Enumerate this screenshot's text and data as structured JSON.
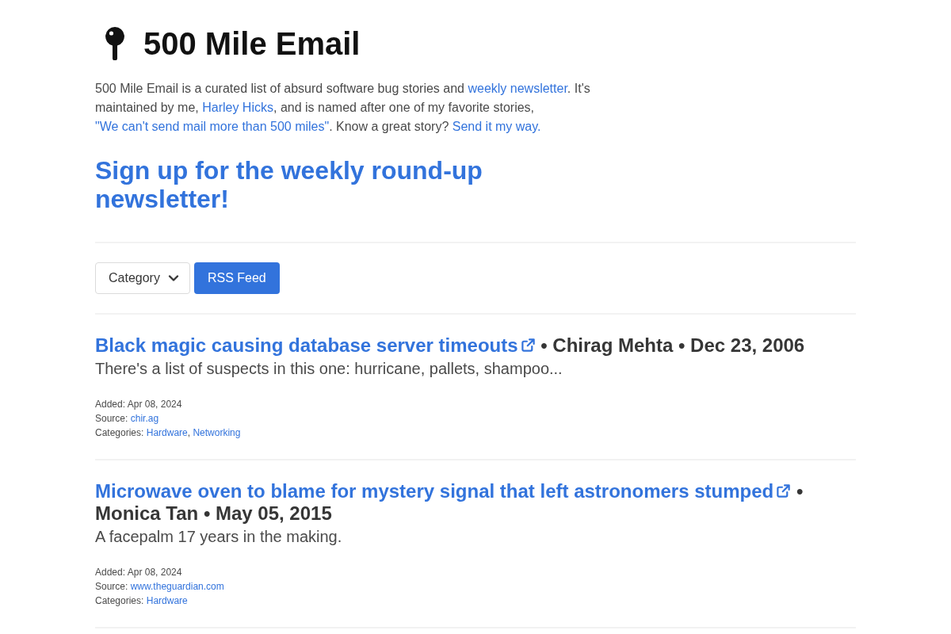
{
  "header": {
    "title": "500 Mile Email"
  },
  "intro": [
    {
      "kind": "text",
      "text": "500 Mile Email is a curated list of absurd software bug stories and "
    },
    {
      "kind": "link",
      "text": "weekly newsletter"
    },
    {
      "kind": "text",
      "text": ". It's maintained by me, "
    },
    {
      "kind": "link",
      "text": "Harley Hicks"
    },
    {
      "kind": "text",
      "text": ", and is named after one of my favorite stories, "
    },
    {
      "kind": "link",
      "text": "\"We can't send mail more than 500 miles\""
    },
    {
      "kind": "text",
      "text": ". Know a great story? "
    },
    {
      "kind": "link",
      "text": "Send it my way."
    }
  ],
  "signup": {
    "label": "Sign up for the weekly round-up newsletter!"
  },
  "filters": {
    "category_dropdown": {
      "label": "Category"
    },
    "rss_button": {
      "label": "RSS Feed"
    }
  },
  "stories": [
    {
      "title": "Black magic causing database server timeouts",
      "byline": {
        "separators": [
          "•",
          "•"
        ],
        "author": "Chirag Mehta",
        "date": "Dec 23, 2006"
      },
      "summary": "There's a list of suspects in this one: hurricane, pallets, shampoo...",
      "meta": [
        {
          "label": "Added:",
          "parts": [
            {
              "kind": "text",
              "text": "Apr 08, 2024"
            }
          ]
        },
        {
          "label": "Source:",
          "parts": [
            {
              "kind": "link",
              "text": "chir.ag"
            }
          ]
        },
        {
          "label": "Categories:",
          "parts": [
            {
              "kind": "link",
              "text": "Hardware"
            },
            {
              "kind": "text",
              "text": ", "
            },
            {
              "kind": "link",
              "text": "Networking"
            }
          ]
        }
      ]
    },
    {
      "title": "Microwave oven to blame for mystery signal that left astronomers stumped",
      "byline": {
        "separators": [
          "•",
          "•"
        ],
        "author": "Monica Tan",
        "date": "May 05, 2015"
      },
      "summary": "A facepalm 17 years in the making.",
      "meta": [
        {
          "label": "Added:",
          "parts": [
            {
              "kind": "text",
              "text": "Apr 08, 2024"
            }
          ]
        },
        {
          "label": "Source:",
          "parts": [
            {
              "kind": "link",
              "text": "www.theguardian.com"
            }
          ]
        },
        {
          "label": "Categories:",
          "parts": [
            {
              "kind": "link",
              "text": "Hardware"
            }
          ]
        }
      ]
    }
  ]
}
